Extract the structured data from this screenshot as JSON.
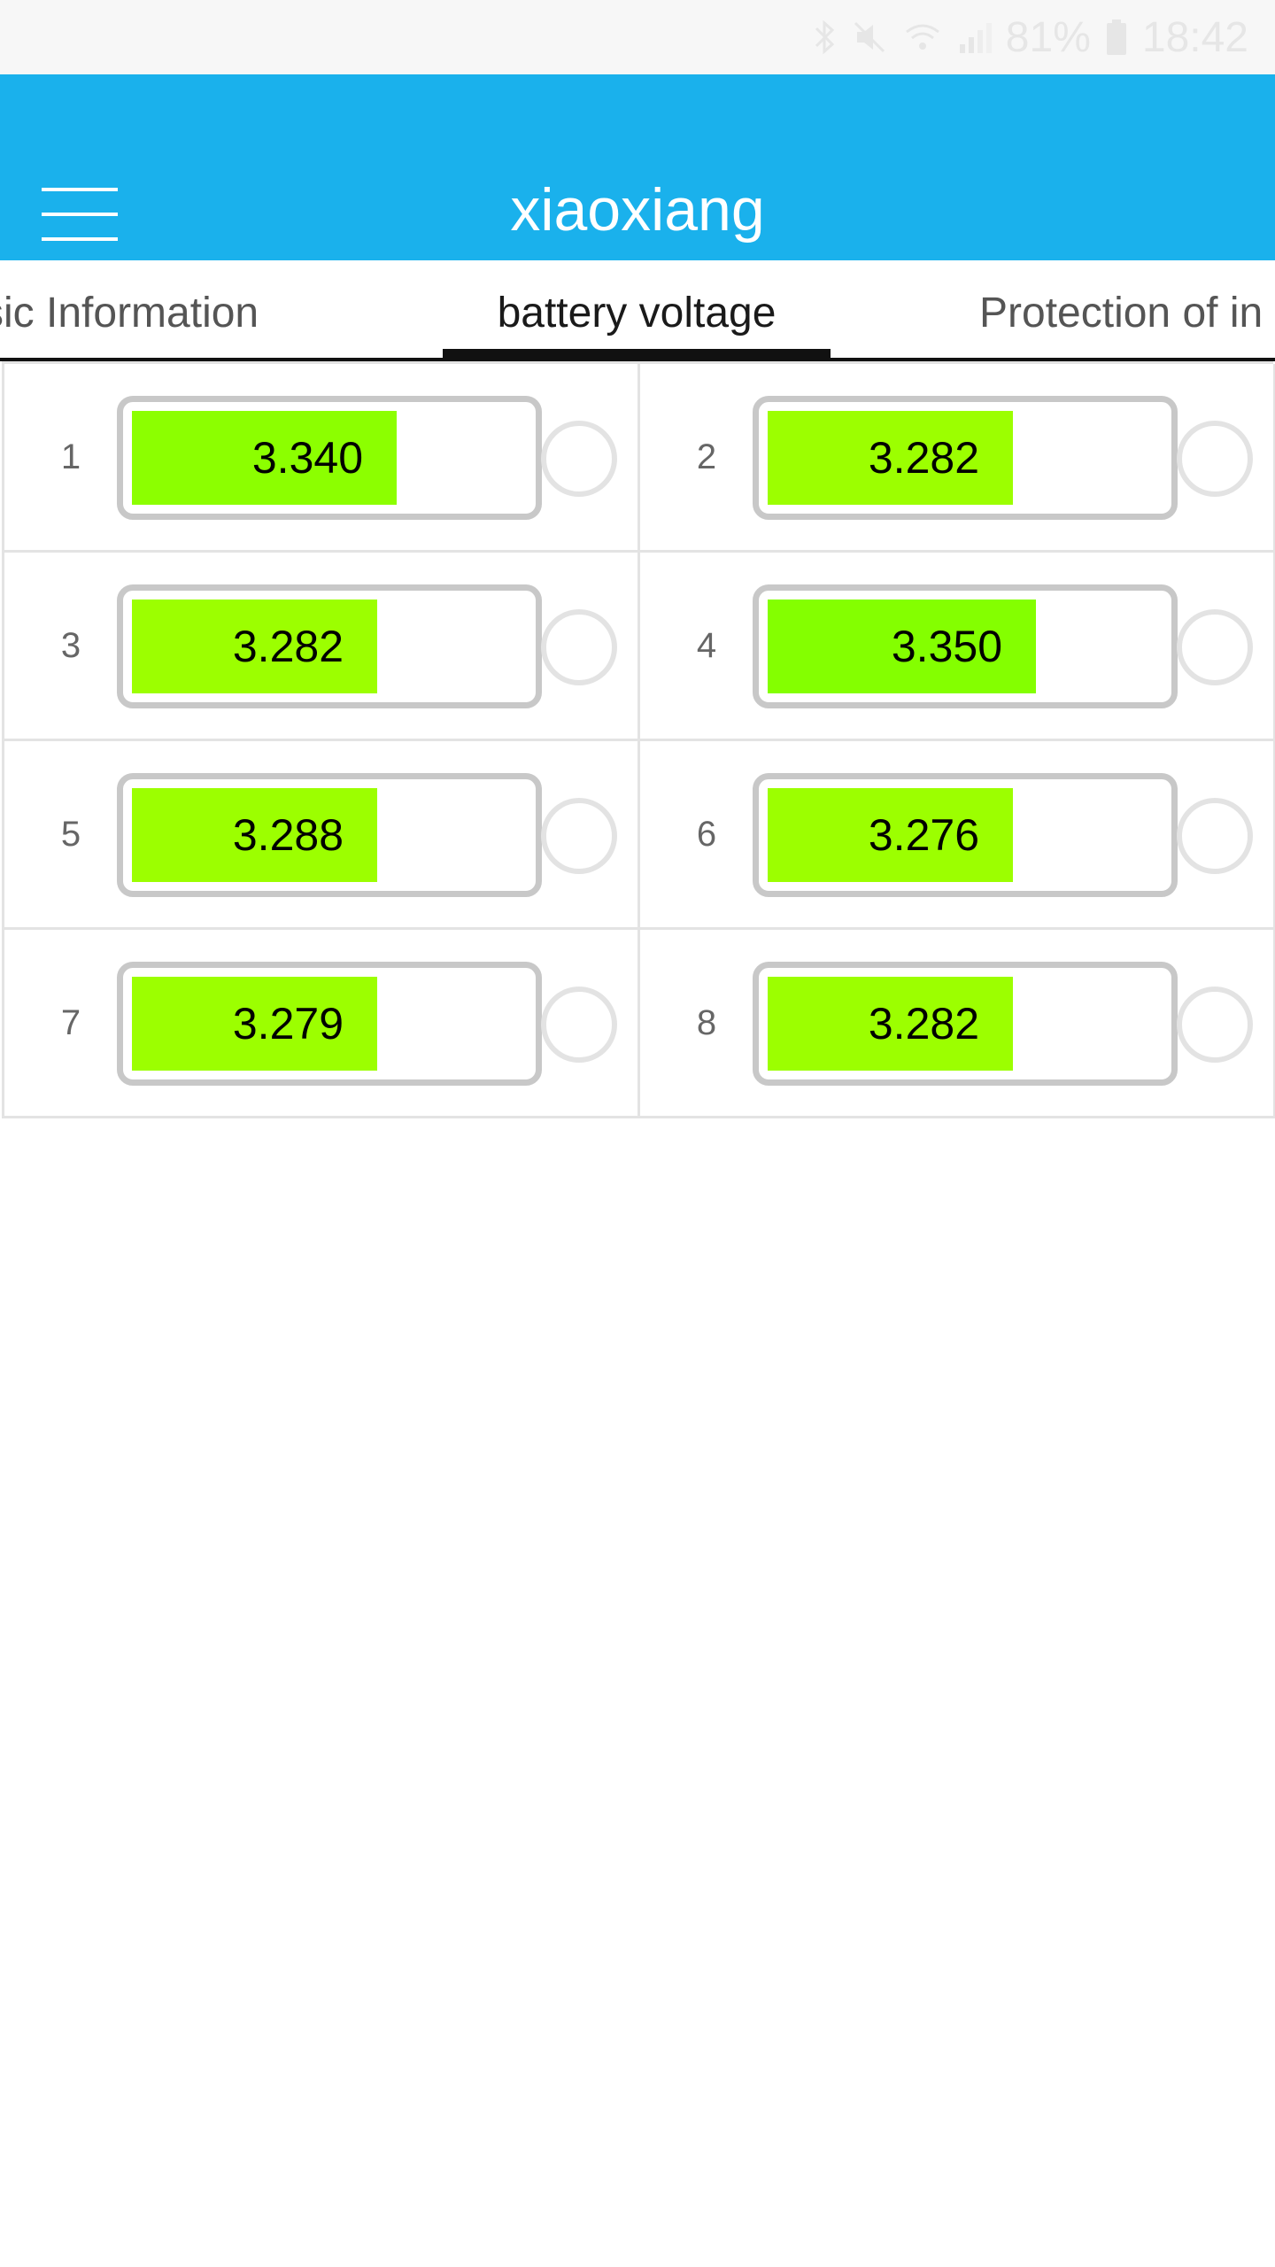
{
  "status_bar": {
    "battery_percent": "81%",
    "time": "18:42"
  },
  "app_bar": {
    "title": "xiaoxiang"
  },
  "tabs": [
    {
      "label": "sic Information"
    },
    {
      "label": "battery voltage"
    },
    {
      "label": "Protection of in"
    }
  ],
  "colors": {
    "app_bar": "#1ab1ec",
    "fill_high": "#84ff00",
    "fill_normal": "#9cff00"
  },
  "cells": [
    {
      "index": "1",
      "voltage": "3.340",
      "fill_level": 0.67,
      "fill_color": "#8cff00"
    },
    {
      "index": "2",
      "voltage": "3.282",
      "fill_level": 0.62,
      "fill_color": "#9cff00"
    },
    {
      "index": "3",
      "voltage": "3.282",
      "fill_level": 0.62,
      "fill_color": "#9cff00"
    },
    {
      "index": "4",
      "voltage": "3.350",
      "fill_level": 0.68,
      "fill_color": "#84ff00"
    },
    {
      "index": "5",
      "voltage": "3.288",
      "fill_level": 0.62,
      "fill_color": "#9cff00"
    },
    {
      "index": "6",
      "voltage": "3.276",
      "fill_level": 0.62,
      "fill_color": "#9cff00"
    },
    {
      "index": "7",
      "voltage": "3.279",
      "fill_level": 0.62,
      "fill_color": "#9cff00"
    },
    {
      "index": "8",
      "voltage": "3.282",
      "fill_level": 0.62,
      "fill_color": "#9cff00"
    }
  ]
}
